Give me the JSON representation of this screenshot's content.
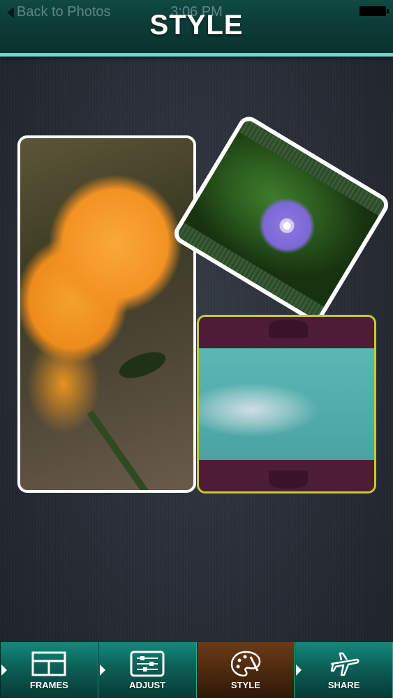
{
  "header": {
    "back_label": "Back to Photos",
    "time": "3:06 PM",
    "title": "STYLE"
  },
  "toolbar": {
    "tabs": [
      {
        "label": "FRAMES",
        "icon": "frames-icon",
        "active": false
      },
      {
        "label": "ADJUST",
        "icon": "adjust-icon",
        "active": false
      },
      {
        "label": "STYLE",
        "icon": "palette-icon",
        "active": true
      },
      {
        "label": "SHARE",
        "icon": "airplane-icon",
        "active": false
      }
    ]
  },
  "colors": {
    "header_bg": "#0c3c37",
    "header_accent": "#67d9cf",
    "toolbar_bg": "#0c5f56",
    "active_tab_bg": "#4e2a0e",
    "canvas_bg": "#272c35"
  }
}
